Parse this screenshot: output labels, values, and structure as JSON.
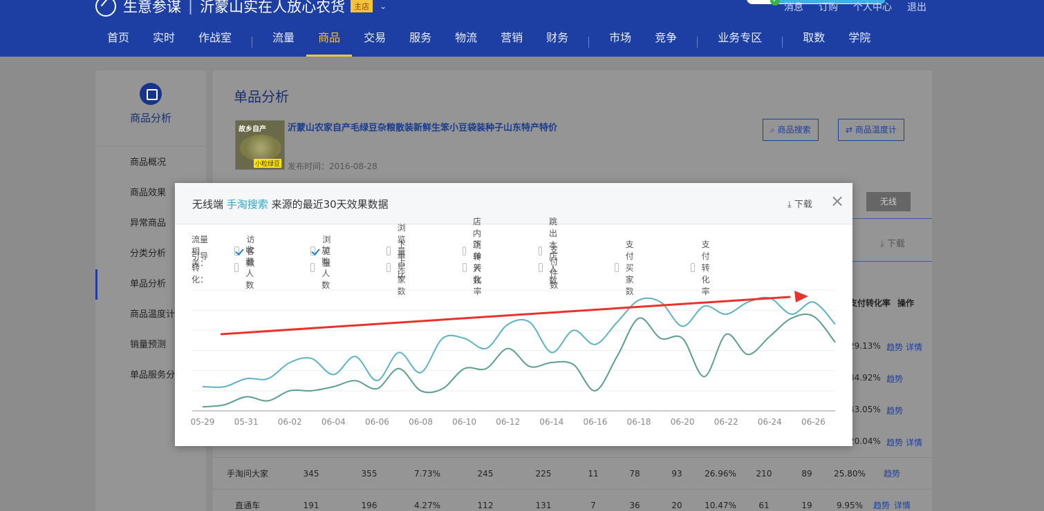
{
  "header": {
    "brand": "生意参谋",
    "shop_name": "沂蒙山实在人放心农货",
    "shop_tag": "主店",
    "top_links": [
      "消息",
      "订购",
      "个人中心",
      "退出"
    ],
    "nav": [
      "首页",
      "实时",
      "作战室",
      "流量",
      "商品",
      "交易",
      "服务",
      "物流",
      "营销",
      "财务",
      "市场",
      "竞争",
      "业务专区",
      "取数",
      "学院"
    ],
    "nav_active": "商品"
  },
  "sidebar": {
    "section_title": "商品分析",
    "items": [
      "商品概况",
      "商品效果",
      "异常商品",
      "分类分析",
      "单品分析",
      "商品温度计",
      "销量预测",
      "单品服务分析"
    ],
    "active": "单品分析"
  },
  "content": {
    "title": "单品分析",
    "product_name": "沂蒙山农家自产毛绿豆杂粮散装新鲜生笨小豆袋装种子山东特产特价",
    "publish_date": "发布时间：2016-08-28",
    "image_text_top": "故乡自产",
    "image_text_bottom": "小粒绿豆",
    "search_button": "商品搜索",
    "thermometer_button": "商品温度计",
    "wireless_tab": "无线",
    "download": "下载",
    "col_header_conversion": "支付转化率",
    "col_header_ops": "操作",
    "right_rows": [
      {
        "rate": "29.13%",
        "links": [
          "趋势",
          "详情"
        ]
      },
      {
        "rate": "34.92%",
        "links": [
          "趋势"
        ]
      },
      {
        "rate": "43.05%",
        "links": [
          "趋势"
        ]
      },
      {
        "rate": "20.04%",
        "links": [
          "趋势",
          "详情"
        ]
      }
    ],
    "table_rows": [
      {
        "source": "手淘问大家",
        "values": [
          "345",
          "355",
          "7.73%",
          "245",
          "225",
          "11",
          "78",
          "93",
          "26.96%",
          "210",
          "89",
          "25.80%"
        ],
        "links": [
          "趋势"
        ]
      },
      {
        "source": "直通车",
        "values": [
          "191",
          "196",
          "4.27%",
          "112",
          "131",
          "7",
          "36",
          "20",
          "10.47%",
          "61",
          "19",
          "9.95%"
        ],
        "links": [
          "趋势",
          "详情"
        ]
      }
    ]
  },
  "modal": {
    "title_prefix": "无线端",
    "title_source": "手淘搜索",
    "title_suffix": "来源的最近30天效果数据",
    "download": "下载",
    "close": "×",
    "group_traffic": "流量相关：",
    "group_conversion": "引导转化：",
    "traffic_metrics": [
      {
        "label": "访客数",
        "checked": true
      },
      {
        "label": "浏览量",
        "checked": true
      },
      {
        "label": "浏览量占比",
        "checked": false
      },
      {
        "label": "店内跳转人数",
        "checked": false
      },
      {
        "label": "跳出本店人数",
        "checked": false
      }
    ],
    "conversion_metrics": [
      {
        "label": "收藏人数",
        "checked": false
      },
      {
        "label": "加购人数",
        "checked": false
      },
      {
        "label": "下单买家数",
        "checked": false
      },
      {
        "label": "下单转化率",
        "checked": false
      },
      {
        "label": "支付件数",
        "checked": false
      },
      {
        "label": "支付买家数",
        "checked": false
      },
      {
        "label": "支付转化率",
        "checked": false
      }
    ],
    "colors": {
      "visitors": "#5a9e8f",
      "pageviews": "#5bb2c2",
      "arrow": "#e8322b",
      "accent": "#2aa7c4"
    }
  },
  "chart_data": {
    "type": "line",
    "x": [
      "05-29",
      "05-30",
      "05-31",
      "06-01",
      "06-02",
      "06-03",
      "06-04",
      "06-05",
      "06-06",
      "06-07",
      "06-08",
      "06-09",
      "06-10",
      "06-11",
      "06-12",
      "06-13",
      "06-14",
      "06-15",
      "06-16",
      "06-17",
      "06-18",
      "06-19",
      "06-20",
      "06-21",
      "06-22",
      "06-23",
      "06-24",
      "06-25",
      "06-26",
      "06-27"
    ],
    "tick_labels": [
      "05-29",
      "05-31",
      "06-02",
      "06-04",
      "06-06",
      "06-08",
      "06-10",
      "06-12",
      "06-14",
      "06-16",
      "06-18",
      "06-20",
      "06-22",
      "06-24",
      "06-26"
    ],
    "series": [
      {
        "values": [
          12,
          12,
          16,
          16,
          24,
          26,
          18,
          27,
          15,
          29,
          19,
          36,
          36,
          31,
          43,
          44,
          29,
          40,
          33,
          44,
          55,
          54,
          42,
          52,
          48,
          54,
          56,
          48,
          54,
          43
        ]
      },
      {
        "values": [
          2,
          3,
          7,
          5,
          10,
          10,
          12,
          15,
          11,
          21,
          10,
          11,
          21,
          21,
          31,
          22,
          24,
          23,
          10,
          27,
          46,
          36,
          36,
          17,
          38,
          28,
          37,
          46,
          47,
          34
        ]
      }
    ],
    "ylim": [
      0,
      60
    ],
    "grid": true
  }
}
